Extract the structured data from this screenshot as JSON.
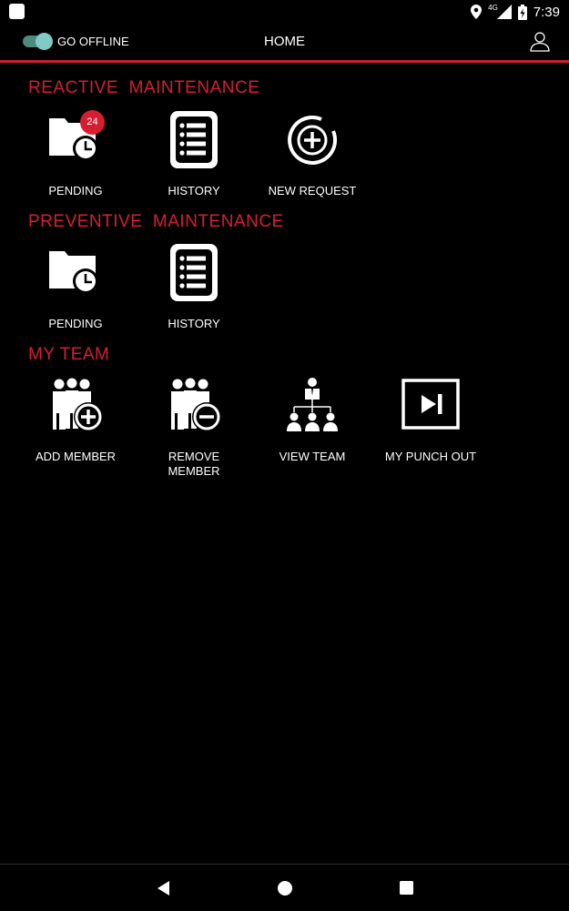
{
  "status_bar": {
    "network": "4G",
    "time": "7:39"
  },
  "header": {
    "toggle_label": "GO OFFLINE",
    "title": "HOME"
  },
  "sections": [
    {
      "title": "REACTIVE  MAINTENANCE",
      "items": [
        {
          "label": "PENDING",
          "icon": "folder-clock-icon",
          "badge": "24"
        },
        {
          "label": "HISTORY",
          "icon": "list-icon"
        },
        {
          "label": "NEW REQUEST",
          "icon": "plus-circle-icon"
        }
      ]
    },
    {
      "title": "PREVENTIVE  MAINTENANCE",
      "items": [
        {
          "label": "PENDING",
          "icon": "folder-clock-icon"
        },
        {
          "label": "HISTORY",
          "icon": "list-icon"
        }
      ]
    },
    {
      "title": "MY TEAM",
      "items": [
        {
          "label": "ADD MEMBER",
          "icon": "group-add-icon"
        },
        {
          "label": "REMOVE MEMBER",
          "icon": "group-remove-icon"
        },
        {
          "label": "VIEW TEAM",
          "icon": "org-chart-icon"
        },
        {
          "label": "MY PUNCH OUT",
          "icon": "play-next-icon"
        }
      ]
    }
  ],
  "colors": {
    "accent": "#d51f31",
    "toggle": "#80cbc4",
    "background": "#000000"
  }
}
